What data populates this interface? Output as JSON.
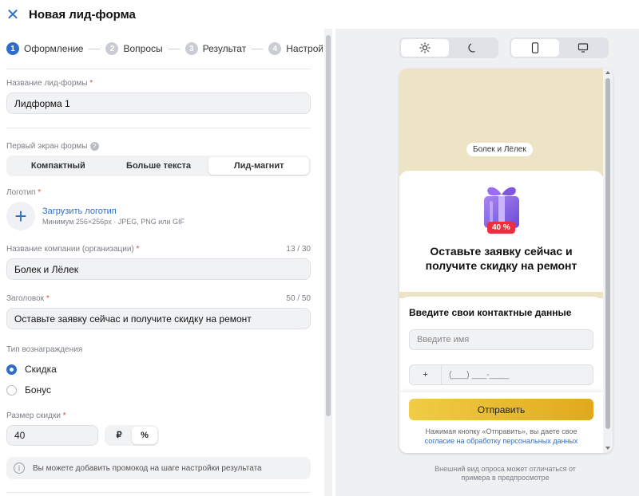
{
  "header": {
    "title": "Новая лид-форма"
  },
  "steps": [
    {
      "num": "1",
      "label": "Оформление"
    },
    {
      "num": "2",
      "label": "Вопросы"
    },
    {
      "num": "3",
      "label": "Результат"
    },
    {
      "num": "4",
      "label": "Настройки"
    }
  ],
  "form_name": {
    "label": "Название лид-формы",
    "value": "Лидформа 1"
  },
  "first_screen": {
    "label": "Первый экран формы",
    "options": [
      "Компактный",
      "Больше текста",
      "Лид-магнит"
    ],
    "selected": "Лид-магнит"
  },
  "logo": {
    "label": "Логотип",
    "upload_label": "Загрузить логотип",
    "hint": "Минимум 256×256px · JPEG, PNG или GIF"
  },
  "company": {
    "label": "Название компании (организации)",
    "counter": "13 / 30",
    "value": "Болек и Лёлек"
  },
  "heading": {
    "label": "Заголовок",
    "counter": "50 / 50",
    "value": "Оставьте заявку сейчас и получите скидку на ремонт"
  },
  "reward": {
    "label": "Тип вознаграждения",
    "options": [
      "Скидка",
      "Бонус"
    ],
    "selected": "Скидка"
  },
  "discount": {
    "label": "Размер скидки",
    "value": "40",
    "units": [
      "₽",
      "%"
    ],
    "selected_unit": "%"
  },
  "info": {
    "text": "Вы можете добавить промокод на шаге настройки результата"
  },
  "preview": {
    "company_pill": "Болек и Лёлек",
    "badge": "40 %",
    "title": "Оставьте заявку сейчас и получите скидку на ремонт",
    "contact_title": "Введите свои контактные данные",
    "name_placeholder": "Введите имя",
    "phone_prefix": "+",
    "phone_mask": "(___) ___-____",
    "submit": "Отправить",
    "consent_text": "Нажимая кнопку «Отправить», вы даете свое",
    "consent_link": "согласие на обработку персональных данных",
    "note": "Внешний вид опроса может отличаться от примера в предпросмотре"
  }
}
